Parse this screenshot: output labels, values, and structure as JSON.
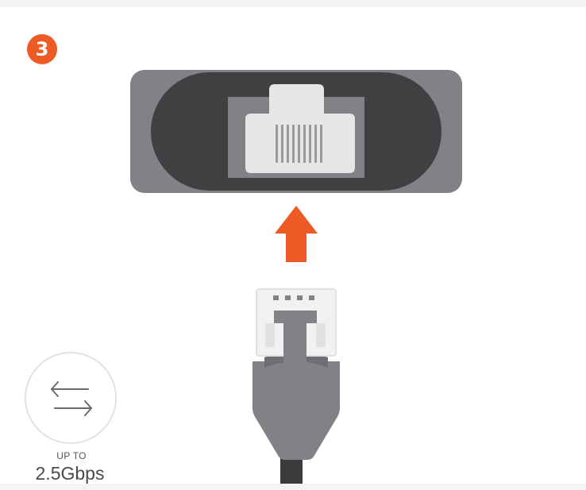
{
  "step": {
    "number": "3"
  },
  "speed": {
    "prefix": "UP TO",
    "value": "2.5Gbps"
  },
  "icons": {
    "transfer": "transfer-arrows-icon",
    "direction": "up-arrow-icon",
    "port": "ethernet-port-icon",
    "connector": "ethernet-plug-icon"
  },
  "colors": {
    "accent": "#ee5a24",
    "port_outer": "#808285",
    "port_inner": "#3f4042",
    "cable": "#808285",
    "cable_dark": "#3a3b3d"
  }
}
